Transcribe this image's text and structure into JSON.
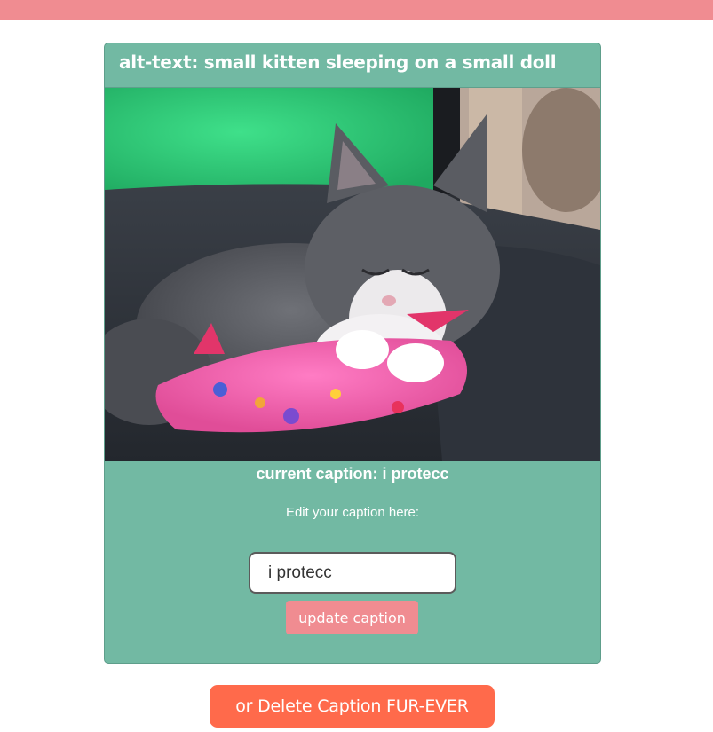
{
  "card": {
    "alt_text": "alt-text: small kitten sleeping on a small doll",
    "current_caption": "current caption: i protecc",
    "edit_label": "Edit your caption here:",
    "caption_input_value": "i protecc",
    "update_button_label": "update caption"
  },
  "delete_button_label": "or Delete Caption FUR-EVER",
  "colors": {
    "top_bar": "#f08c91",
    "card_background": "#72b9a3",
    "update_button": "#f08c91",
    "delete_button": "#ff6a4b"
  }
}
